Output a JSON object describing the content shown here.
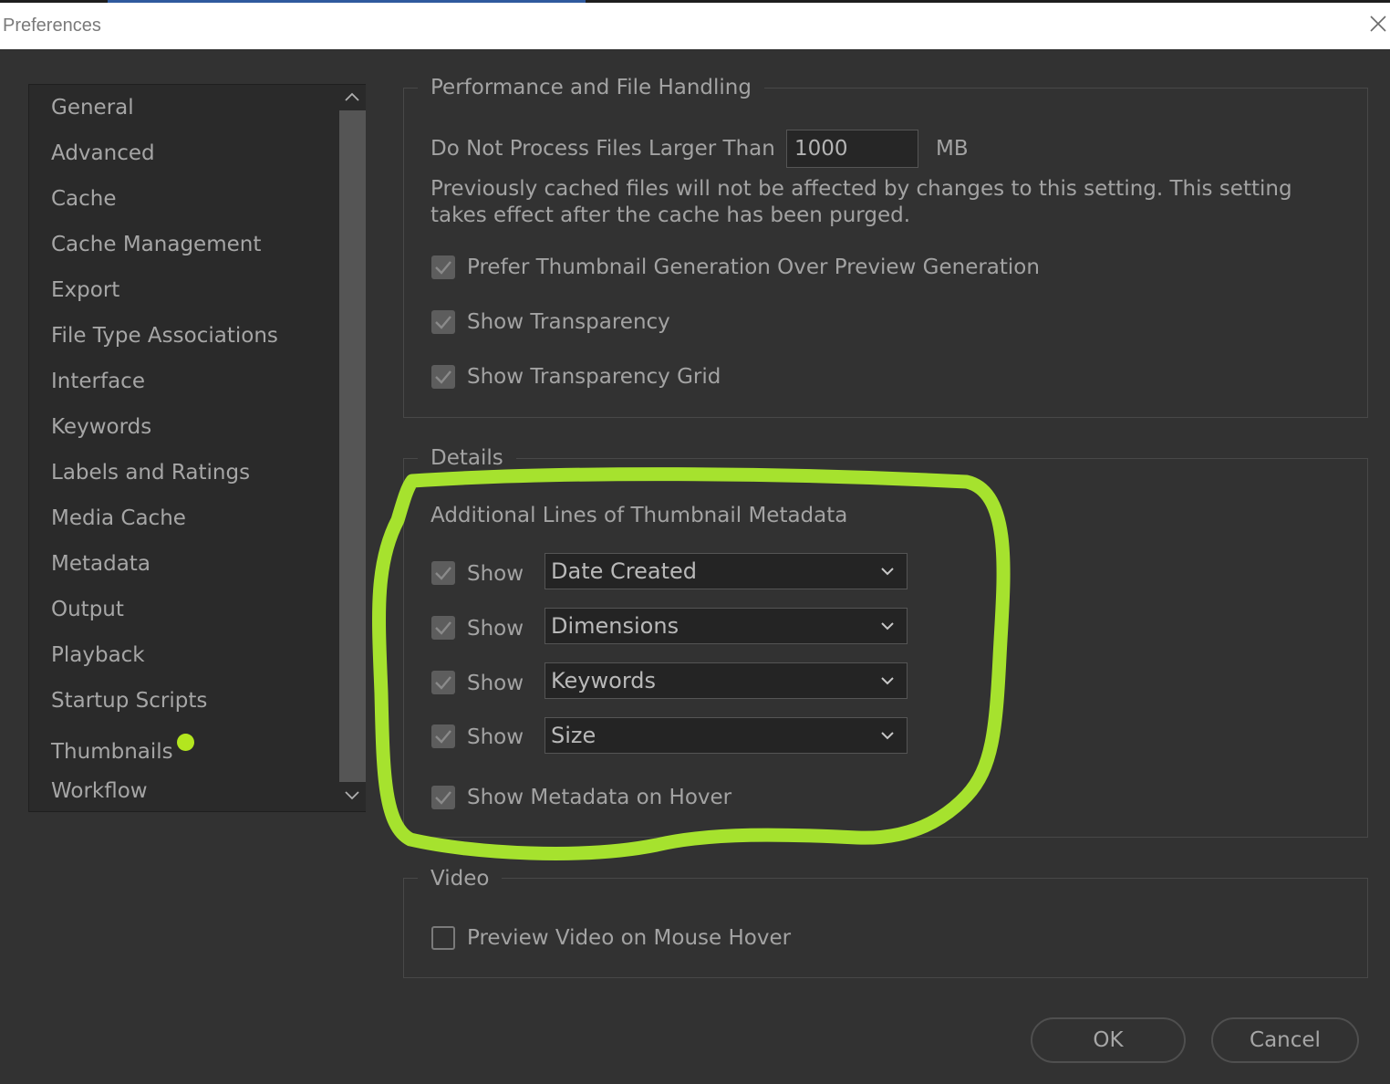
{
  "window": {
    "title": "Preferences"
  },
  "sidebar": {
    "items": [
      {
        "label": "General"
      },
      {
        "label": "Advanced"
      },
      {
        "label": "Cache"
      },
      {
        "label": "Cache Management"
      },
      {
        "label": "Export"
      },
      {
        "label": "File Type Associations"
      },
      {
        "label": "Interface"
      },
      {
        "label": "Keywords"
      },
      {
        "label": "Labels and Ratings"
      },
      {
        "label": "Media Cache"
      },
      {
        "label": "Metadata"
      },
      {
        "label": "Output"
      },
      {
        "label": "Playback"
      },
      {
        "label": "Startup Scripts"
      },
      {
        "label": "Thumbnails",
        "marked": true
      },
      {
        "label": "Workflow"
      }
    ],
    "marker_color": "#b3e61f"
  },
  "performance": {
    "legend": "Performance and File Handling",
    "max_size_label": "Do Not Process Files Larger Than",
    "max_size_value": "1000",
    "max_size_unit": "MB",
    "note_line1": "Previously cached files will not be affected by changes to this setting. This setting",
    "note_line2": "takes effect after the cache has been purged.",
    "options": [
      {
        "label": "Prefer Thumbnail Generation Over Preview Generation",
        "checked": true
      },
      {
        "label": "Show Transparency",
        "checked": true
      },
      {
        "label": "Show Transparency Grid",
        "checked": true
      }
    ]
  },
  "details": {
    "legend": "Details",
    "subheading": "Additional Lines of Thumbnail Metadata",
    "rows": [
      {
        "show_label": "Show",
        "checked": true,
        "value": "Date Created"
      },
      {
        "show_label": "Show",
        "checked": true,
        "value": "Dimensions"
      },
      {
        "show_label": "Show",
        "checked": true,
        "value": "Keywords"
      },
      {
        "show_label": "Show",
        "checked": true,
        "value": "Size"
      }
    ],
    "hover_option": {
      "label": "Show Metadata on Hover",
      "checked": true
    }
  },
  "video": {
    "legend": "Video",
    "option": {
      "label": "Preview Video on Mouse Hover",
      "checked": false
    }
  },
  "buttons": {
    "ok": "OK",
    "cancel": "Cancel"
  },
  "annotation": {
    "color": "#a6e22e"
  }
}
